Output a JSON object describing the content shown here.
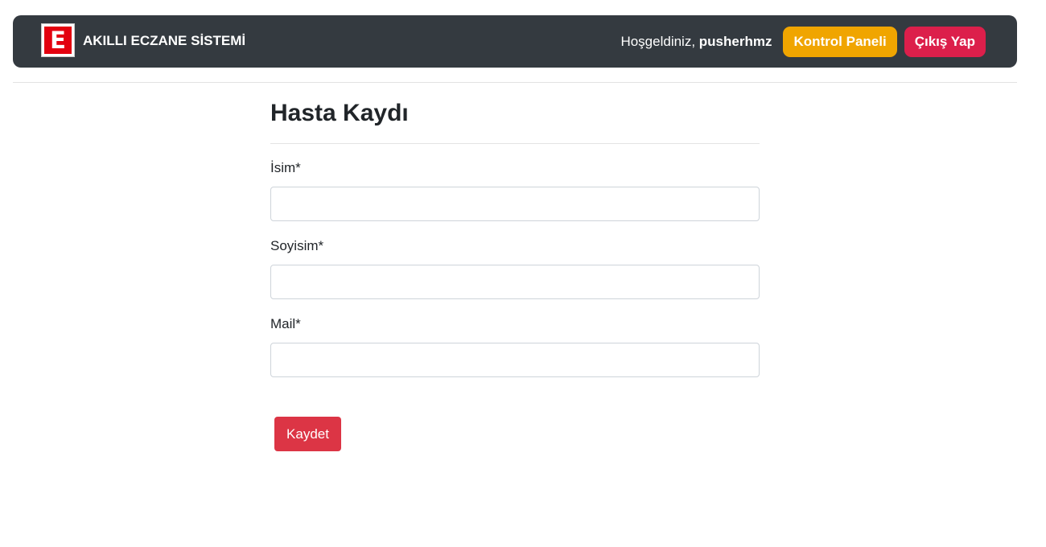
{
  "navbar": {
    "brand_logo_letter": "E",
    "brand_name": "AKILLI ECZANE SİSTEMİ",
    "welcome_prefix": "Hoşgeldiniz, ",
    "username": "pusherhmz",
    "dashboard_label": "Kontrol Paneli",
    "logout_label": "Çıkış Yap",
    "colors": {
      "background": "#343a40",
      "dashboard_button": "#f0a500",
      "logout_button": "#dc1f4b",
      "logo_red": "#e3000f"
    }
  },
  "form": {
    "title": "Hasta Kaydı",
    "fields": [
      {
        "label": "İsim*",
        "value": "",
        "placeholder": ""
      },
      {
        "label": "Soyisim*",
        "value": "",
        "placeholder": ""
      },
      {
        "label": "Mail*",
        "value": "",
        "placeholder": ""
      }
    ],
    "submit_label": "Kaydet",
    "submit_color": "#dc3545"
  }
}
